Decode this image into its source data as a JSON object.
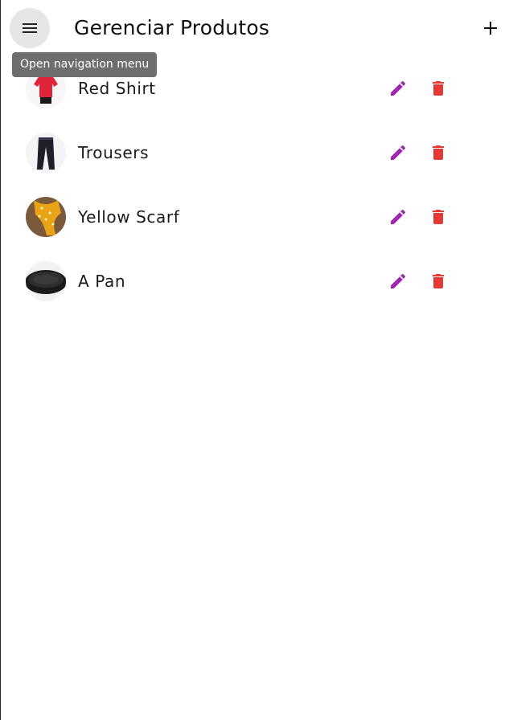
{
  "appbar": {
    "title": "Gerenciar Produtos",
    "menu_icon": "menu-icon",
    "add_icon": "add-icon",
    "tooltip": "Open navigation menu"
  },
  "colors": {
    "edit": "#9c27b0",
    "delete": "#e53935",
    "menu_button_bg": "#e6e6e6",
    "tooltip_bg": "#6e6e6e"
  },
  "products": [
    {
      "name": "Red Shirt",
      "image": "red-shirt-thumbnail"
    },
    {
      "name": "Trousers",
      "image": "trousers-thumbnail"
    },
    {
      "name": "Yellow Scarf",
      "image": "yellow-scarf-thumbnail"
    },
    {
      "name": "A Pan",
      "image": "pan-thumbnail"
    }
  ],
  "row_actions": {
    "edit_icon": "pencil-icon",
    "delete_icon": "trash-icon"
  }
}
